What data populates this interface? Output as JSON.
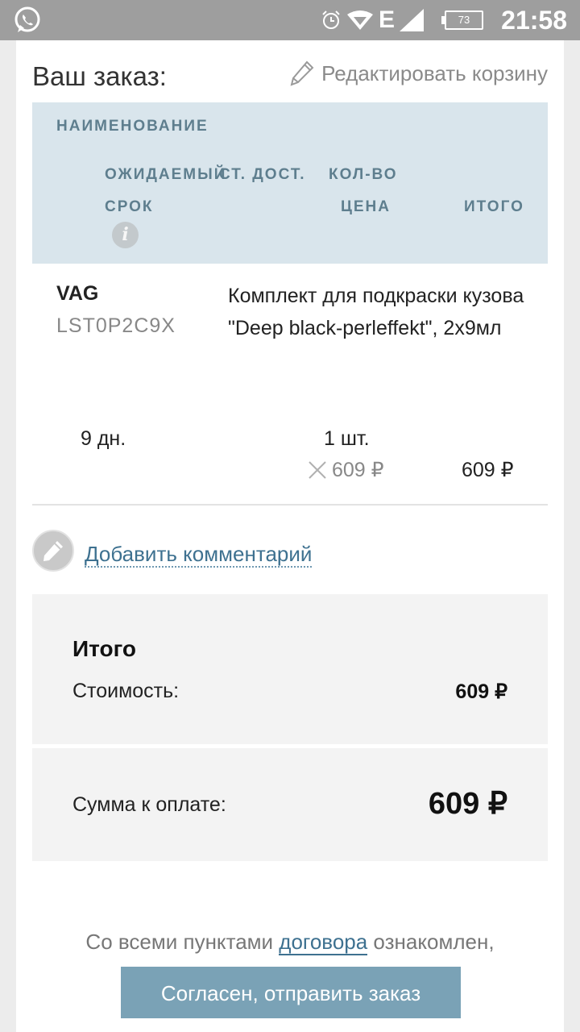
{
  "status_bar": {
    "battery": "73",
    "time": "21:58",
    "network": "E"
  },
  "header": {
    "title": "Ваш заказ:",
    "edit_cart_label": "Редактировать корзину"
  },
  "table_header": {
    "name": "НАИМЕНОВАНИЕ",
    "expected": "ОЖИДАЕМЫЙ",
    "availability": "СТ. ДОСТ.",
    "quantity": "КОЛ-ВО",
    "term": "СРОК",
    "price": "ЦЕНА",
    "total": "ИТОГО",
    "info_glyph": "i"
  },
  "item": {
    "brand": "VAG",
    "article": "LST0P2C9X",
    "name": "Комплект для подкраски кузова \"Deep black-perleffekt\", 2x9мл",
    "term": "9 дн.",
    "quantity": "1 шт.",
    "price": "609 ₽",
    "total": "609 ₽"
  },
  "comment": {
    "link_label": "Добавить комментарий"
  },
  "summary": {
    "title": "Итого",
    "cost_label": "Стоимость:",
    "cost_value": "609 ₽",
    "pay_label": "Сумма к оплате:",
    "pay_value": "609 ₽"
  },
  "footer": {
    "agree_before": "Со всеми пунктами ",
    "agree_link": "договора",
    "agree_after": " ознакомлен,",
    "submit_label": "Согласен, отправить заказ"
  },
  "colors": {
    "accent": "#3e7190",
    "header_bg": "#d9e5ec",
    "button_bg": "#7aa2b6",
    "statusbar_bg": "#9e9e9e"
  }
}
